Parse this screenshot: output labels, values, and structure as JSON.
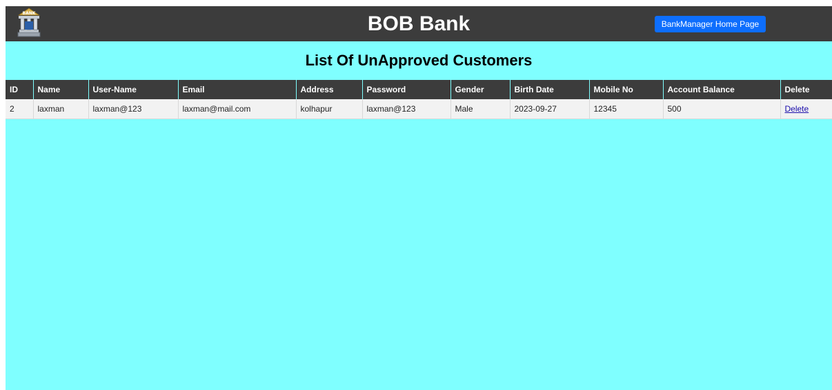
{
  "navbar": {
    "logo_text": "BANK",
    "brand": "BOB Bank",
    "home_button": "BankManager Home Page"
  },
  "page_title": "List Of UnApproved Customers",
  "table": {
    "headers": [
      "ID",
      "Name",
      "User-Name",
      "Email",
      "Address",
      "Password",
      "Gender",
      "Birth Date",
      "Mobile No",
      "Account Balance",
      "Delete"
    ],
    "rows": [
      {
        "id": "2",
        "name": "laxman",
        "username": "laxman@123",
        "email": "laxman@mail.com",
        "address": "kolhapur",
        "password": "laxman@123",
        "gender": "Male",
        "birth_date": "2023-09-27",
        "mobile": "12345",
        "balance": "500",
        "delete": "Delete"
      }
    ]
  },
  "colors": {
    "navbar": "#3c3c3c",
    "background": "#7fffff",
    "button": "#0d6efd"
  }
}
